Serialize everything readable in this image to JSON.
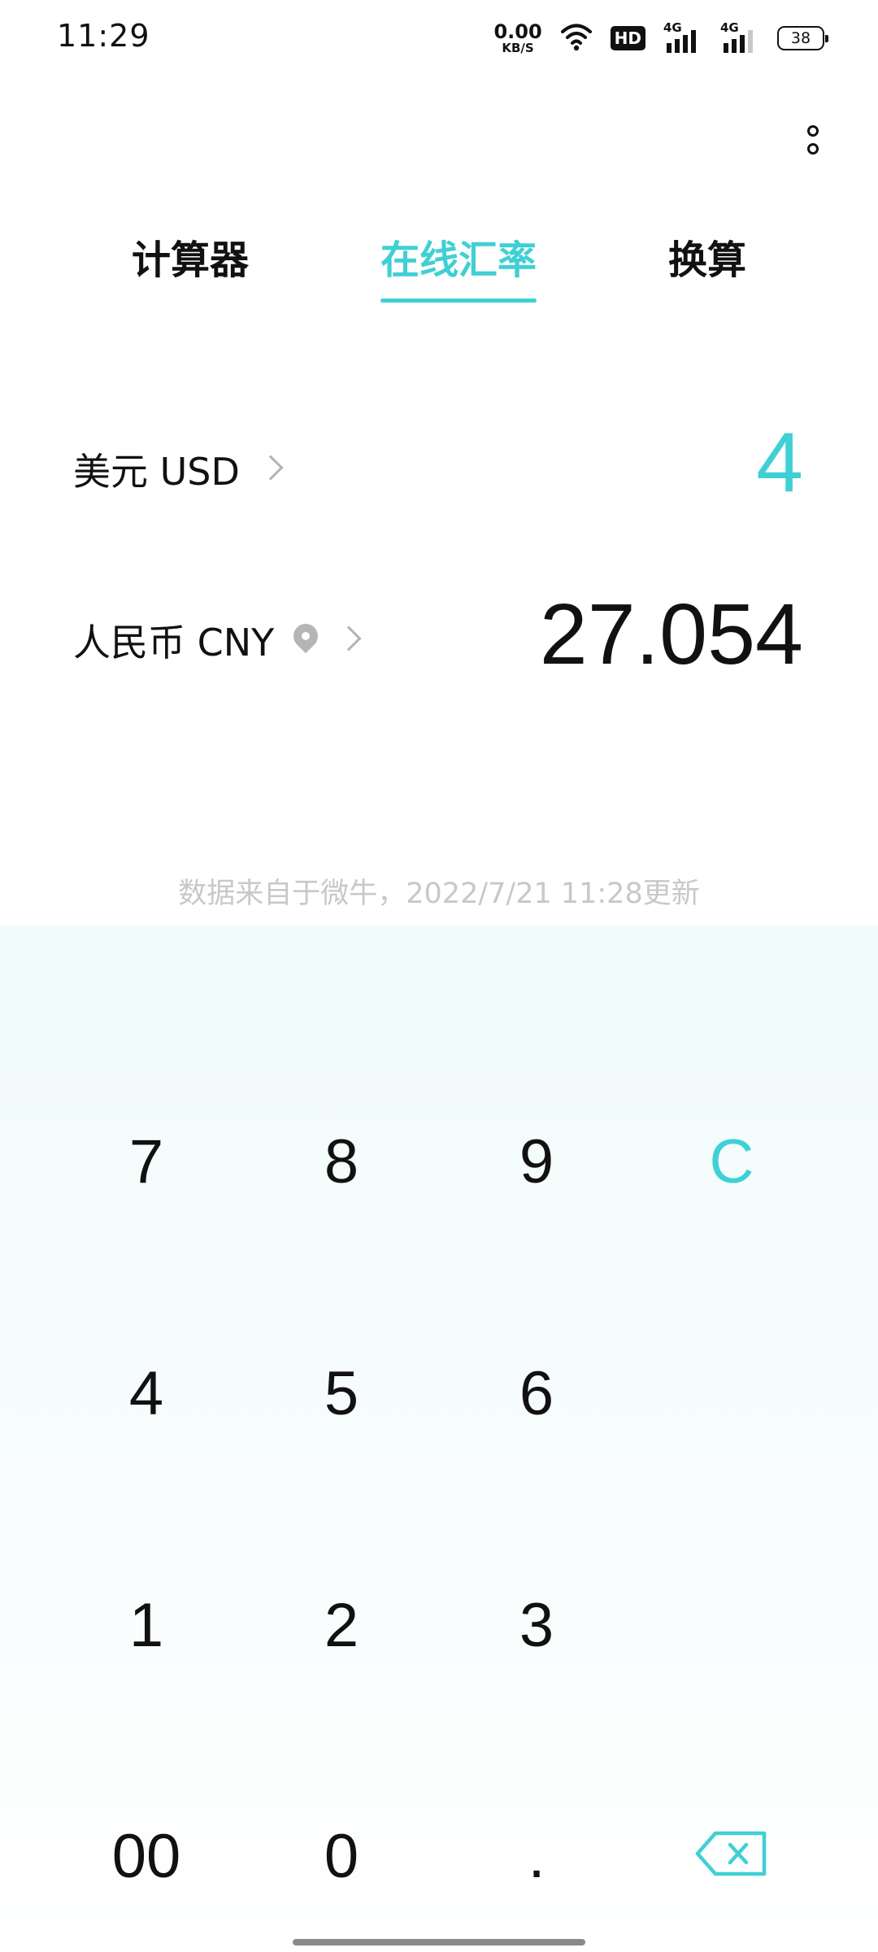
{
  "status_bar": {
    "time": "11:29",
    "net_speed_value": "0.00",
    "net_speed_unit": "KB/S",
    "hd_label": "HD",
    "sim1_label": "4G",
    "sim2_label": "4G",
    "battery": "38",
    "icons": [
      "wifi-icon",
      "signal-icon",
      "signal-icon",
      "battery-icon"
    ]
  },
  "tabs": [
    {
      "label": "计算器",
      "active": false
    },
    {
      "label": "在线汇率",
      "active": true
    },
    {
      "label": "换算",
      "active": false
    }
  ],
  "converter": {
    "from": {
      "currency": "美元 USD",
      "amount": "4"
    },
    "to": {
      "currency": "人民币 CNY",
      "amount": "27.054"
    }
  },
  "data_source": "数据来自于微牛，2022/7/21 11:28更新",
  "keypad": {
    "k7": "7",
    "k8": "8",
    "k9": "9",
    "clear": "C",
    "k4": "4",
    "k5": "5",
    "k6": "6",
    "k1": "1",
    "k2": "2",
    "k3": "3",
    "k00": "00",
    "k0": "0",
    "dot": "."
  },
  "colors": {
    "accent": "#3fd0d4",
    "keypad_bg": "#f1fbfc",
    "muted_text": "#c8c8c8"
  }
}
